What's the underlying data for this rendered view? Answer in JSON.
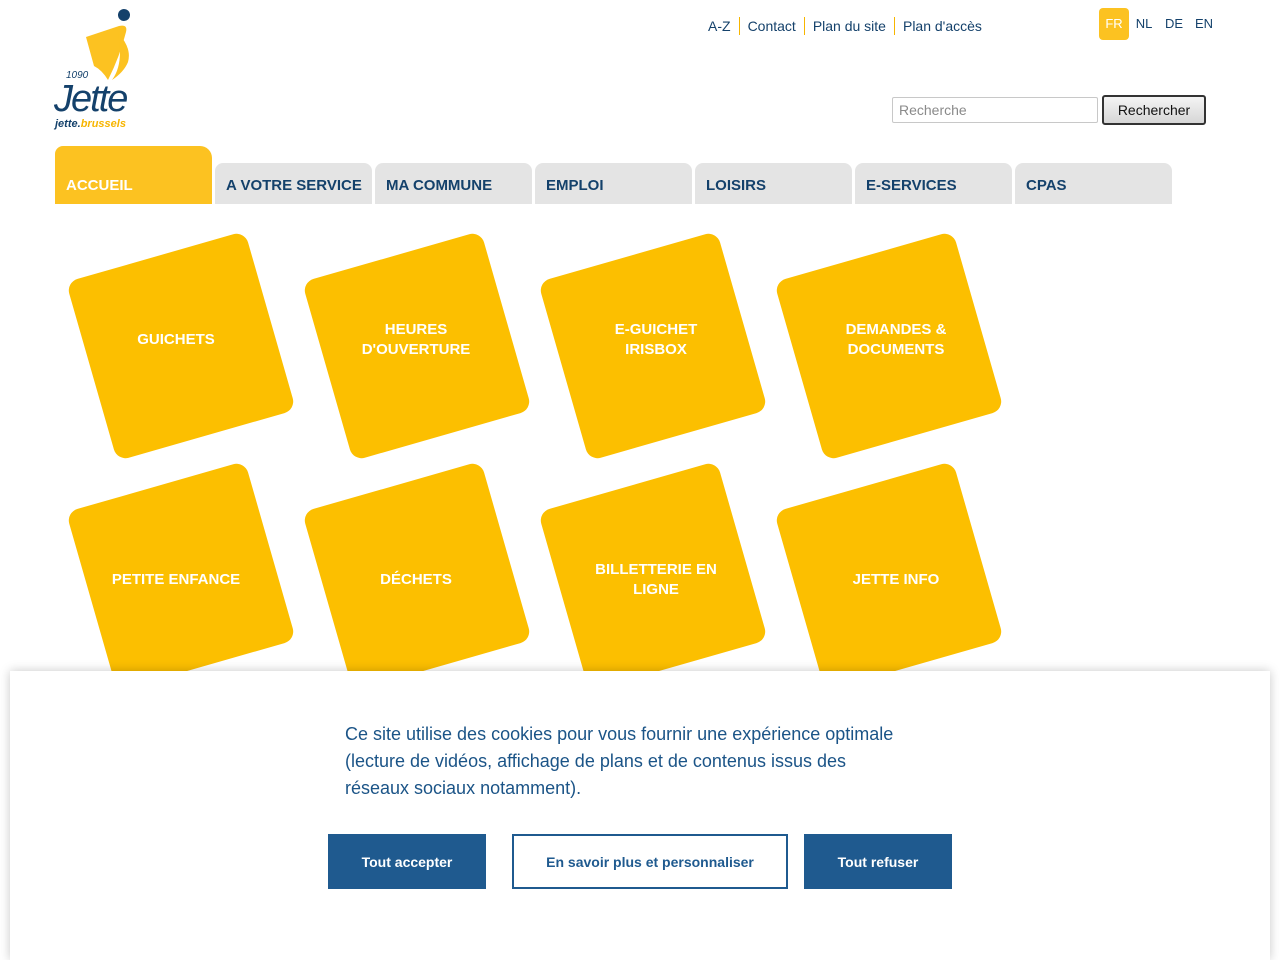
{
  "logo": {
    "postcode": "1090",
    "name": "Jette",
    "url_prefix": "jette.",
    "url_suffix": "brussels",
    "colors": {
      "navy": "#14416b",
      "yellow": "#fcc221"
    }
  },
  "toplinks": [
    "A-Z",
    "Contact",
    "Plan du site",
    "Plan d'accès"
  ],
  "languages": {
    "active": "FR",
    "items": [
      "FR",
      "NL",
      "DE",
      "EN"
    ]
  },
  "search": {
    "placeholder": "Recherche",
    "value": "",
    "button_label": "Rechercher"
  },
  "nav": {
    "tabs": [
      "ACCUEIL",
      "A VOTRE SERVICE",
      "MA COMMUNE",
      "EMPLOI",
      "LOISIRS",
      "E-SERVICES",
      "CPAS"
    ],
    "active": "ACCUEIL"
  },
  "tiles": [
    {
      "line1": "GUICHETS",
      "line2": ""
    },
    {
      "line1": "HEURES",
      "line2": "D'OUVERTURE"
    },
    {
      "line1": "E-GUICHET",
      "line2": "IRISBOX"
    },
    {
      "line1": "DEMANDES &",
      "line2": "DOCUMENTS"
    },
    {
      "line1": "PETITE ENFANCE",
      "line2": ""
    },
    {
      "line1": "DÉCHETS",
      "line2": ""
    },
    {
      "line1": "BILLETTERIE EN",
      "line2": "LIGNE"
    },
    {
      "line1": "JETTE INFO",
      "line2": ""
    }
  ],
  "cookie_banner": {
    "text": "Ce site utilise des cookies pour vous fournir une expérience optimale (lecture de vidéos, affichage de plans et de contenus issus des réseaux sociaux notamment).",
    "accept_label": "Tout accepter",
    "customize_label": "En savoir plus et personnaliser",
    "refuse_label": "Tout refuser"
  },
  "colors": {
    "brand_navy": "#14416b",
    "brand_yellow": "#fcc221",
    "tile_yellow": "#fcbf00",
    "tab_grey": "#e4e4e4",
    "cookie_blue": "#1f5a8f"
  }
}
